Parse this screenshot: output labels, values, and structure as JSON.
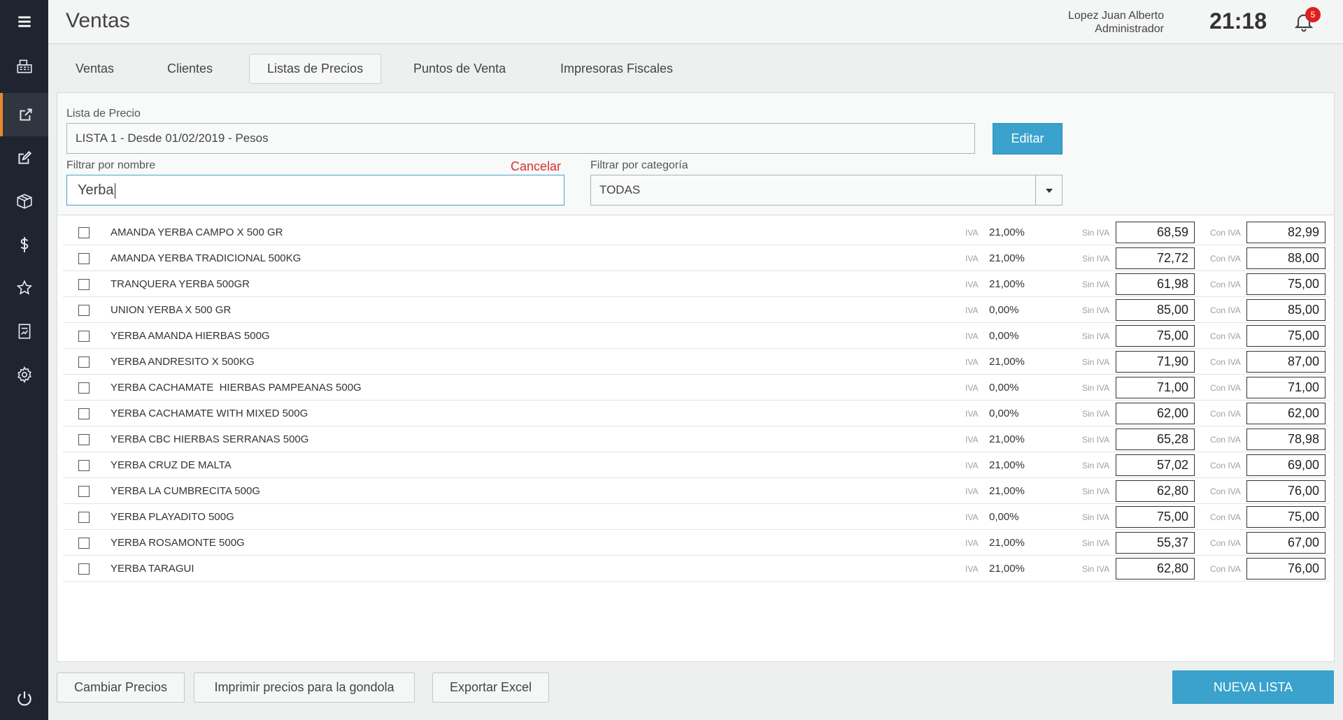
{
  "header": {
    "title": "Ventas",
    "user_name": "Lopez Juan Alberto",
    "user_role": "Administrador",
    "clock": "21:18",
    "notifications_count": "5"
  },
  "sidebar": {
    "items": [
      {
        "icon": "menu-icon"
      },
      {
        "icon": "cash-register-icon"
      },
      {
        "icon": "external-link-icon",
        "active": true
      },
      {
        "icon": "edit-square-icon"
      },
      {
        "icon": "box-icon"
      },
      {
        "icon": "dollar-icon"
      },
      {
        "icon": "star-icon"
      },
      {
        "icon": "report-icon"
      },
      {
        "icon": "gear-icon"
      },
      {
        "icon": "power-icon"
      }
    ],
    "active_color": "#e38a2e"
  },
  "tabs": [
    {
      "label": "Ventas"
    },
    {
      "label": "Clientes"
    },
    {
      "label": "Listas de Precios",
      "active": true
    },
    {
      "label": "Puntos de Venta"
    },
    {
      "label": "Impresoras Fiscales"
    }
  ],
  "filters": {
    "price_list_label": "Lista de Precio",
    "price_list_value": "LISTA 1 - Desde 01/02/2019 - Pesos",
    "edit_button": "Editar",
    "name_filter_label": "Filtrar por nombre",
    "name_filter_value": "Yerba",
    "cancel_link": "Cancelar",
    "category_filter_label": "Filtrar por categoría",
    "category_value": "TODAS"
  },
  "list": {
    "iva_label": "IVA",
    "sin_iva_label": "Sin IVA",
    "con_iva_label": "Con IVA",
    "rows": [
      {
        "name": "AMANDA YERBA CAMPO X 500 GR",
        "iva": "21,00%",
        "sin_iva": "68,59",
        "con_iva": "82,99"
      },
      {
        "name": "AMANDA YERBA TRADICIONAL 500KG",
        "iva": "21,00%",
        "sin_iva": "72,72",
        "con_iva": "88,00"
      },
      {
        "name": "TRANQUERA YERBA 500GR",
        "iva": "21,00%",
        "sin_iva": "61,98",
        "con_iva": "75,00"
      },
      {
        "name": "UNION YERBA X 500 GR",
        "iva": "0,00%",
        "sin_iva": "85,00",
        "con_iva": "85,00"
      },
      {
        "name": "YERBA AMANDA HIERBAS 500G",
        "iva": "0,00%",
        "sin_iva": "75,00",
        "con_iva": "75,00"
      },
      {
        "name": "YERBA ANDRESITO X 500KG",
        "iva": "21,00%",
        "sin_iva": "71,90",
        "con_iva": "87,00"
      },
      {
        "name": "YERBA CACHAMATE  HIERBAS PAMPEANAS 500G",
        "iva": "0,00%",
        "sin_iva": "71,00",
        "con_iva": "71,00"
      },
      {
        "name": "YERBA CACHAMATE WITH MIXED 500G",
        "iva": "0,00%",
        "sin_iva": "62,00",
        "con_iva": "62,00"
      },
      {
        "name": "YERBA CBC HIERBAS SERRANAS 500G",
        "iva": "21,00%",
        "sin_iva": "65,28",
        "con_iva": "78,98"
      },
      {
        "name": "YERBA CRUZ DE MALTA",
        "iva": "21,00%",
        "sin_iva": "57,02",
        "con_iva": "69,00"
      },
      {
        "name": "YERBA LA CUMBRECITA 500G",
        "iva": "21,00%",
        "sin_iva": "62,80",
        "con_iva": "76,00"
      },
      {
        "name": "YERBA PLAYADITO 500G",
        "iva": "0,00%",
        "sin_iva": "75,00",
        "con_iva": "75,00"
      },
      {
        "name": "YERBA ROSAMONTE 500G",
        "iva": "21,00%",
        "sin_iva": "55,37",
        "con_iva": "67,00"
      },
      {
        "name": "YERBA TARAGUI",
        "iva": "21,00%",
        "sin_iva": "62,80",
        "con_iva": "76,00"
      }
    ]
  },
  "footer": {
    "change_prices": "Cambiar Precios",
    "print_prices": "Imprimir precios para la gondola",
    "export_excel": "Exportar Excel",
    "new_list": "NUEVA LISTA"
  },
  "colors": {
    "accent": "#3aa2cc",
    "sidebar_bg": "#1f2530",
    "cancel": "#d9302b",
    "badge": "#e01e1e"
  }
}
